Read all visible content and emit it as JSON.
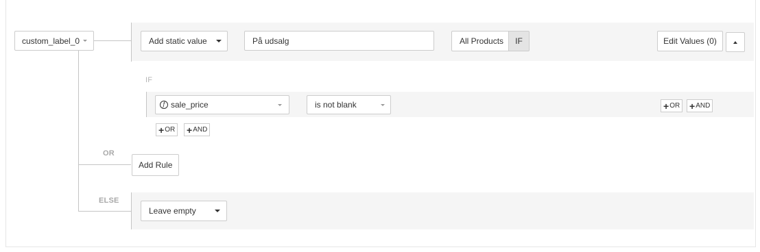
{
  "field_selector": {
    "label": "custom_label_0"
  },
  "rule": {
    "value_mode": "Add static value",
    "value_text": "På udsalg",
    "scope_label": "All Products",
    "if_label": "IF",
    "edit_values_label": "Edit Values (0)"
  },
  "condition": {
    "header": "IF",
    "field": "sale_price",
    "operator": "is not blank",
    "or_label": "OR",
    "and_label": "AND"
  },
  "or_section": {
    "label": "OR",
    "add_rule_label": "Add Rule"
  },
  "else_section": {
    "label": "ELSE",
    "value_mode": "Leave empty"
  },
  "icons": {
    "function": "function-icon",
    "plus": "plus-icon",
    "caret": "caret-down-icon",
    "collapse": "caret-up-icon"
  }
}
